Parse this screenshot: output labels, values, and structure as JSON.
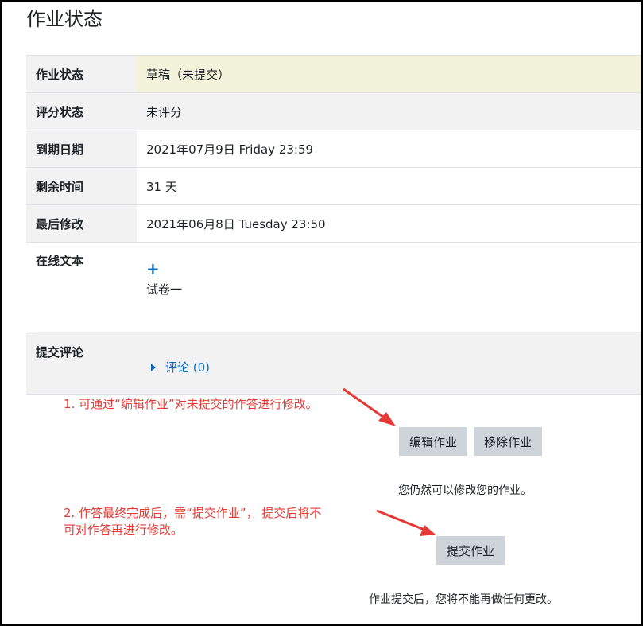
{
  "page_title": "作业状态",
  "status": {
    "rows": [
      {
        "label": "作业状态",
        "value": "草稿（未提交）"
      },
      {
        "label": "评分状态",
        "value": "未评分"
      },
      {
        "label": "到期日期",
        "value": "2021年07月9日 Friday 23:59"
      },
      {
        "label": "剩余时间",
        "value": "31 天"
      },
      {
        "label": "最后修改",
        "value": "2021年06月8日 Tuesday 23:50"
      }
    ],
    "online_text": {
      "label": "在线文本",
      "value": "试卷一"
    },
    "comments": {
      "label": "提交评论",
      "link": "评论 (0)"
    }
  },
  "actions": {
    "edit_label": "编辑作业",
    "remove_label": "移除作业",
    "edit_note": "您仍然可以修改您的作业。",
    "submit_label": "提交作业",
    "submit_note": "作业提交后，您将不能再做任何更改。"
  },
  "annotations": {
    "note1": "1. 可通过“编辑作业”对未提交的作答进行修改。",
    "note2_line1": "2. 作答最终完成后，需“提交作业”， 提交后将不",
    "note2_line2": "可对作答再进行修改。",
    "color": "#e53935"
  },
  "colors": {
    "draft_bg": "#f3f2db",
    "link": "#0f6cbf",
    "button_bg": "#ced4da"
  }
}
